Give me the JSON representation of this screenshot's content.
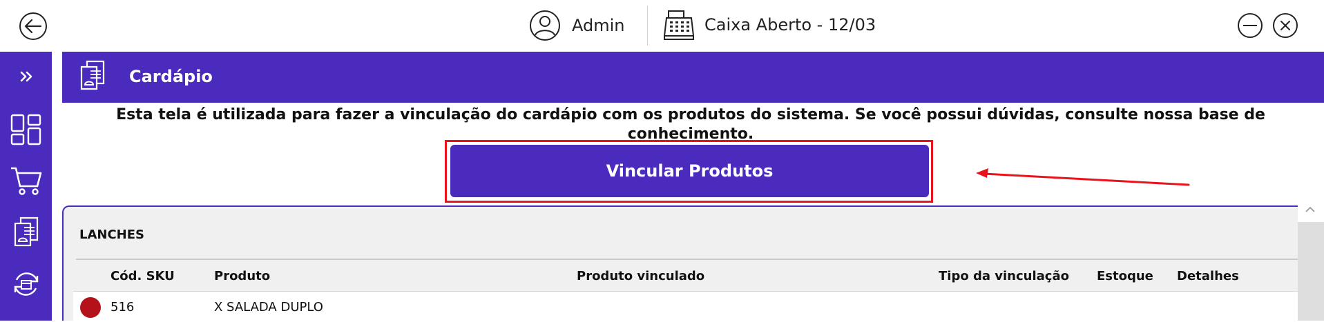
{
  "topbar": {
    "user_name": "Admin",
    "register_status": "Caixa Aberto - 12/03"
  },
  "page": {
    "title": "Cardápio",
    "info_text": "Esta tela é utilizada para fazer a vinculação do cardápio com os produtos do sistema. Se você possui dúvidas, consulte nossa base de conhecimento.",
    "primary_button_label": "Vincular Produtos"
  },
  "table": {
    "section_title": "LANCHES",
    "columns": [
      "Cód. SKU",
      "Produto",
      "Produto vinculado",
      "Tipo da vinculação",
      "Estoque",
      "Detalhes"
    ],
    "rows": [
      {
        "sku": "516",
        "produto": "X SALADA DUPLO",
        "status_color": "#b3121a"
      }
    ]
  },
  "colors": {
    "accent": "#4b2bbd",
    "highlight": "#e8141c",
    "status_unlinked": "#b3121a"
  },
  "icons": {
    "back": "arrow-left-icon",
    "user": "user-circle-icon",
    "register": "cash-register-icon",
    "minimize": "minimize-icon",
    "close": "close-icon",
    "expand": "double-chevron-right-icon",
    "dashboard": "dashboard-icon",
    "cart": "cart-icon",
    "menu": "menu-card-icon",
    "sync": "sync-icon"
  }
}
